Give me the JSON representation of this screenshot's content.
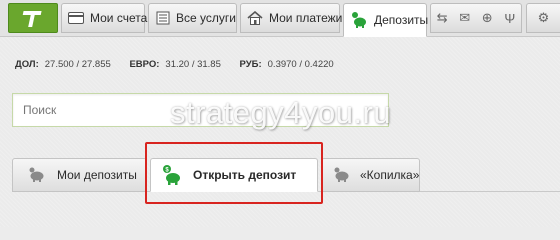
{
  "nav": {
    "tabs": [
      {
        "label": "Мои счета",
        "icon": "card-icon"
      },
      {
        "label": "Все услуги",
        "icon": "list-icon"
      },
      {
        "label": "Мои платежи",
        "icon": "home-icon"
      },
      {
        "label": "Депозиты",
        "icon": "piggy-bank-icon"
      }
    ],
    "extra_icons": [
      "transfer-icon",
      "cash-icon",
      "globe-icon",
      "ukraine-emblem-icon"
    ],
    "last_icon": "settings-icon"
  },
  "rates": [
    {
      "label": "ДОЛ:",
      "value": "27.500 / 27.855"
    },
    {
      "label": "ЕВРО:",
      "value": "31.20 / 31.85"
    },
    {
      "label": "РУБ:",
      "value": "0.3970 / 0.4220"
    }
  ],
  "search": {
    "placeholder": "Поиск"
  },
  "watermark": "strategy4you.ru",
  "subtabs": [
    {
      "label": "Мои депозиты",
      "icon": "piggy-bank-icon"
    },
    {
      "label": "Открыть депозит",
      "icon": "piggy-bank-plus-icon"
    },
    {
      "label": "«Копилка»",
      "icon": "piggy-bank-icon"
    }
  ],
  "colors": {
    "brand": "#6aa72d",
    "highlight": "#d8241f",
    "accent_green": "#2aa33a"
  }
}
